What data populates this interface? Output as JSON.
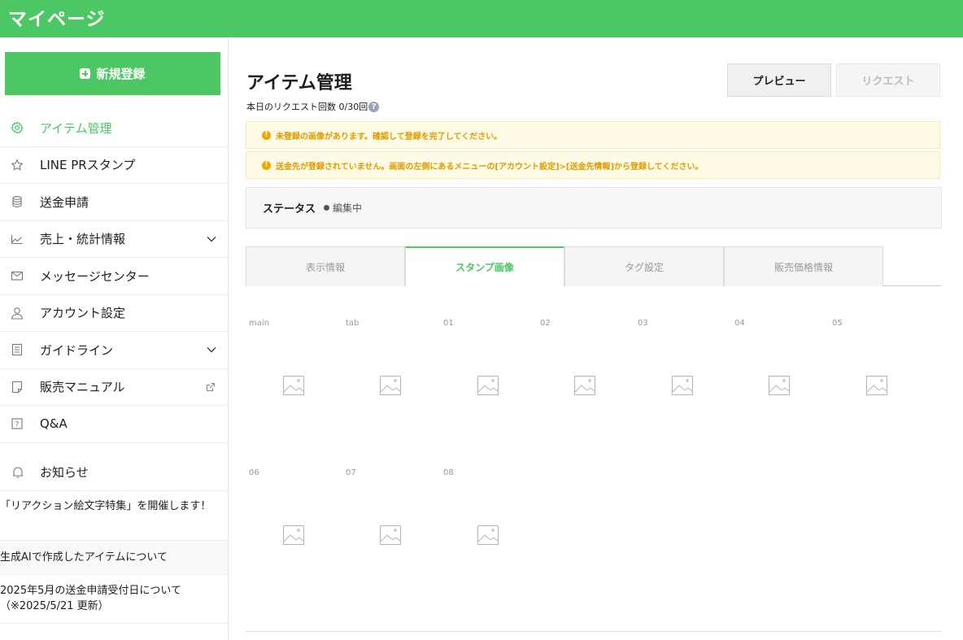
{
  "header": {
    "title": "マイページ"
  },
  "sidebar": {
    "new_button": "新規登録",
    "items": [
      {
        "label": "アイテム管理",
        "icon": "gear-icon",
        "active": true
      },
      {
        "label": "LINE PRスタンプ",
        "icon": "star-icon"
      },
      {
        "label": "送金申請",
        "icon": "database-icon"
      },
      {
        "label": "売上・統計情報",
        "icon": "chart-icon",
        "chevron": true
      },
      {
        "label": "メッセージセンター",
        "icon": "mail-icon"
      },
      {
        "label": "アカウント設定",
        "icon": "user-icon"
      },
      {
        "label": "ガイドライン",
        "icon": "document-icon",
        "chevron": true
      },
      {
        "label": "販売マニュアル",
        "icon": "note-icon",
        "external": true
      },
      {
        "label": "Q&A",
        "icon": "question-icon"
      }
    ],
    "news": {
      "title": "お知らせ",
      "items": [
        "「リアクション絵文字特集」を開催します！",
        "生成AIで作成したアイテムについて",
        "2025年5月の送金申請受付日について（※2025/5/21 更新）"
      ]
    }
  },
  "main": {
    "title": "アイテム管理",
    "request_count": "本日のリクエスト回数 0/30回",
    "preview_button": "プレビュー",
    "request_button": "リクエスト",
    "alerts": [
      "未登録の画像があります。確認して登録を完了してください。",
      "送金先が登録されていません。画面の左側にあるメニューの[アカウント設定]>[送金先情報]から登録してください。"
    ],
    "status_label": "ステータス",
    "status_value": "編集中",
    "tabs": [
      "表示情報",
      "スタンプ画像",
      "タグ設定",
      "販売価格情報"
    ],
    "image_slots": [
      "main",
      "tab",
      "01",
      "02",
      "03",
      "04",
      "05",
      "06",
      "07",
      "08"
    ]
  },
  "colors": {
    "brand": "#4cc764",
    "warning": "#e09a00"
  }
}
